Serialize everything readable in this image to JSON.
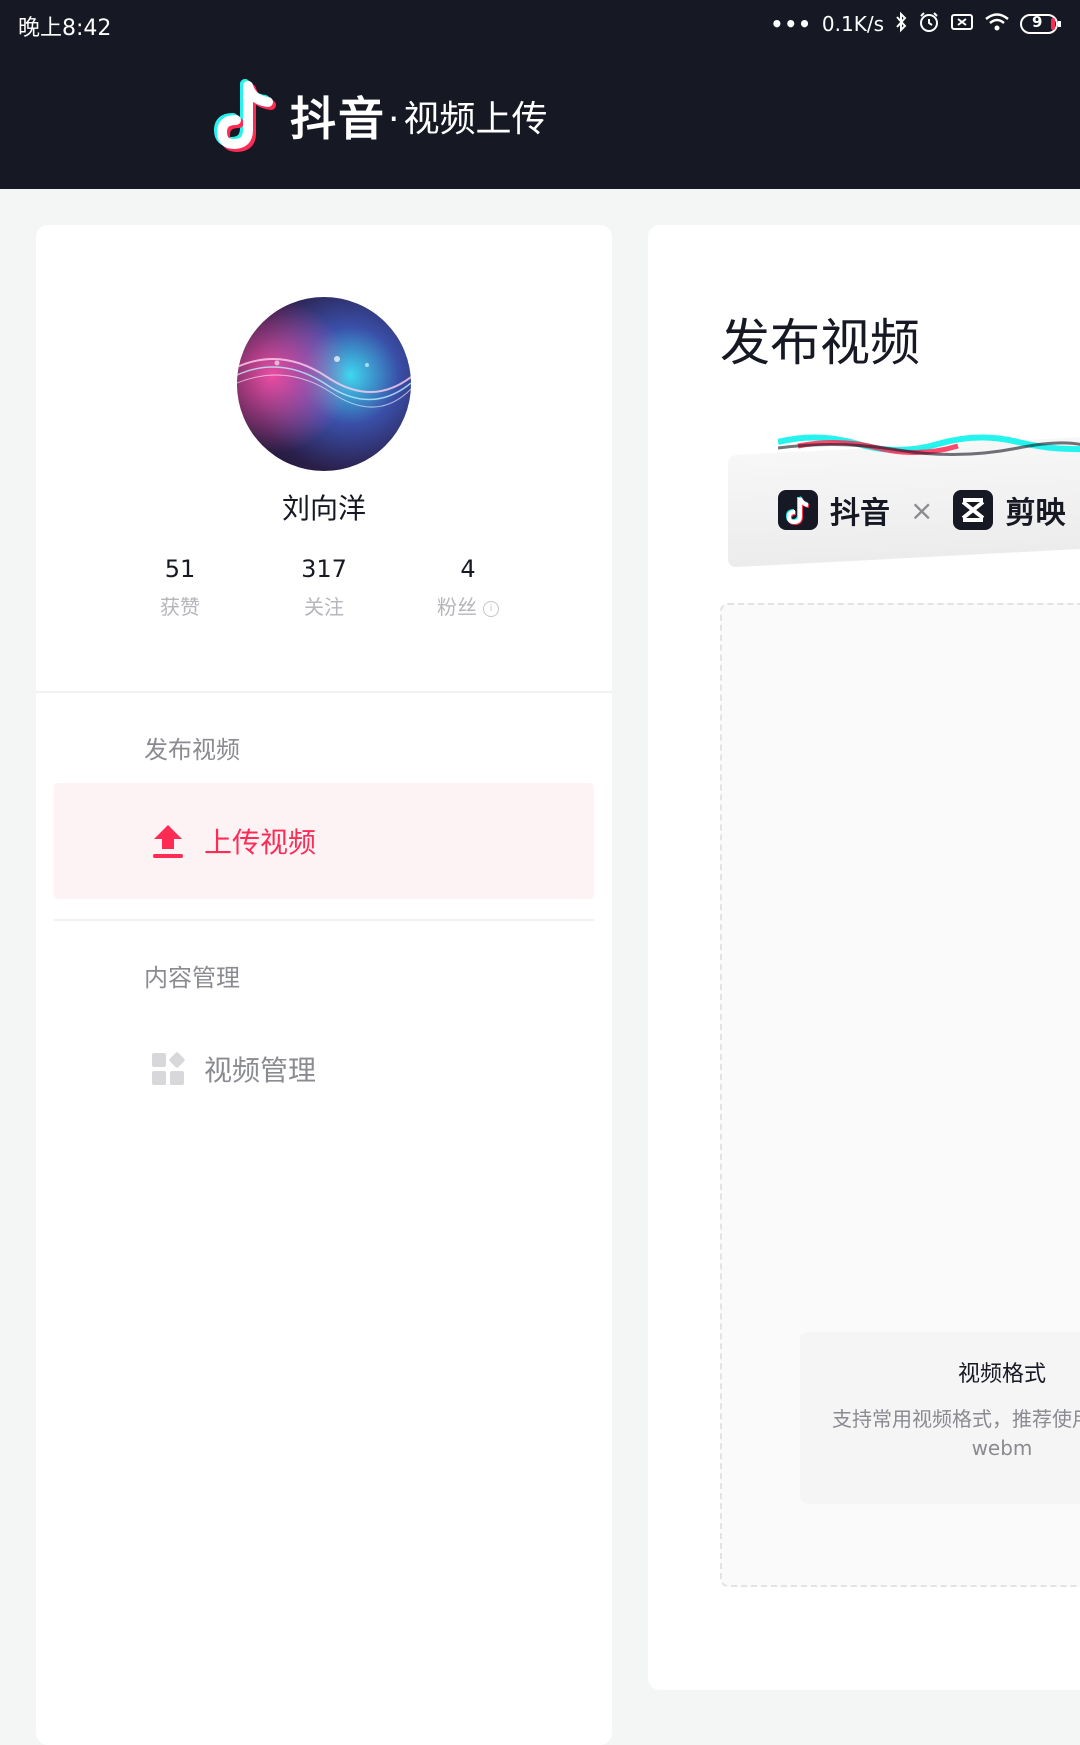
{
  "status_bar": {
    "time": "晚上8:42",
    "speed": "0.1K/s",
    "battery": "9"
  },
  "header": {
    "brand": "抖音",
    "subtitle": "视频上传"
  },
  "profile": {
    "name": "刘向洋",
    "stats": [
      {
        "value": "51",
        "label": "获赞"
      },
      {
        "value": "317",
        "label": "关注"
      },
      {
        "value": "4",
        "label": "粉丝"
      }
    ]
  },
  "sidebar": {
    "section1": "发布视频",
    "upload": "上传视频",
    "section2": "内容管理",
    "manage": "视频管理"
  },
  "main": {
    "title": "发布视频",
    "banner_brand1": "抖音",
    "banner_x": "×",
    "banner_brand2": "剪映",
    "format_title": "视频格式",
    "format_desc": "支持常用视频格式，推荐使用",
    "format_desc2": "webm"
  },
  "colors": {
    "header_bg": "#161823",
    "accent": "#fe2c55",
    "active_bg": "#fef3f4"
  }
}
